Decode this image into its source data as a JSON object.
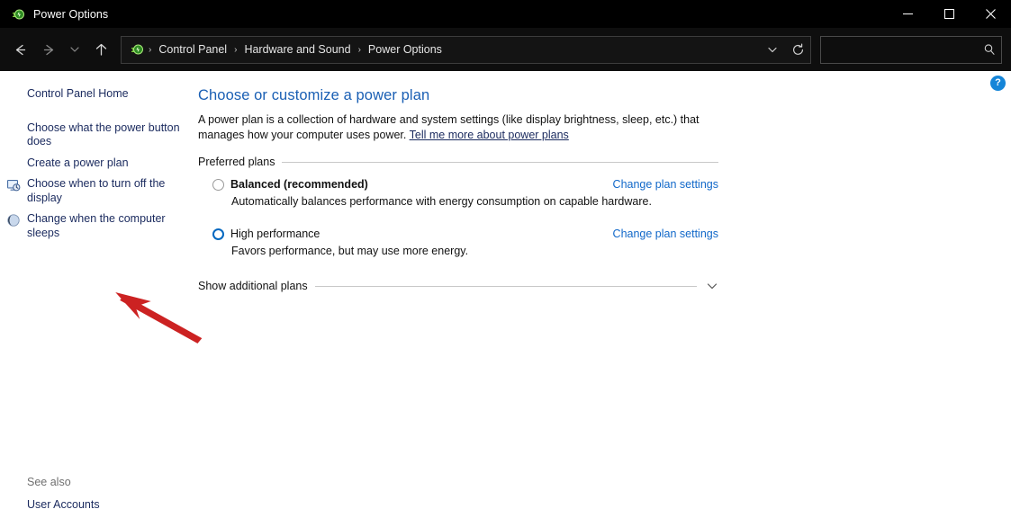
{
  "window": {
    "title": "Power Options",
    "app_icon": "power-plug-icon",
    "minimize_label": "Minimize",
    "maximize_label": "Maximize",
    "close_label": "Close"
  },
  "toolbar": {
    "back_label": "Back",
    "forward_label": "Forward",
    "recent_label": "Recent locations",
    "up_label": "Up",
    "breadcrumb": [
      "Control Panel",
      "Hardware and Sound",
      "Power Options"
    ],
    "breadcrumb_separator": "›",
    "dropdown_label": "Previous locations",
    "refresh_label": "Refresh",
    "search_value": "",
    "search_placeholder": ""
  },
  "sidebar": {
    "items": [
      {
        "label": "Control Panel Home",
        "icon": ""
      },
      {
        "label": "Choose what the power button does",
        "icon": ""
      },
      {
        "label": "Create a power plan",
        "icon": ""
      },
      {
        "label": "Choose when to turn off the display",
        "icon": "monitor-clock-icon"
      },
      {
        "label": "Change when the computer sleeps",
        "icon": "moon-sleep-icon"
      }
    ],
    "see_also_label": "See also",
    "see_also_link": "User Accounts"
  },
  "content": {
    "help_label": "?",
    "title": "Choose or customize a power plan",
    "description_before": "A power plan is a collection of hardware and system settings (like display brightness, sleep, etc.) that manages how your computer uses power. ",
    "description_link": "Tell me more about power plans",
    "group_label": "Preferred plans",
    "plans": [
      {
        "name": "Balanced (recommended)",
        "description": "Automatically balances performance with energy consumption on capable hardware.",
        "action": "Change plan settings",
        "selected": false,
        "bold": true
      },
      {
        "name": "High performance",
        "description": "Favors performance, but may use more energy.",
        "action": "Change plan settings",
        "selected": true,
        "bold": false
      }
    ],
    "show_additional_plans": "Show additional plans",
    "expand_icon": "chevron-down-icon"
  },
  "annotation": {
    "arrow_color": "#cc2222",
    "points_at": "Show additional plans"
  },
  "colors": {
    "link_blue": "#1168c9",
    "title_blue": "#1a5fb4",
    "sidebar_link": "#1a2a5e",
    "accent": "#0067c0",
    "titlebar_bg": "#000000",
    "toolbar_bg": "#0e0e0e",
    "content_bg": "#ffffff"
  }
}
